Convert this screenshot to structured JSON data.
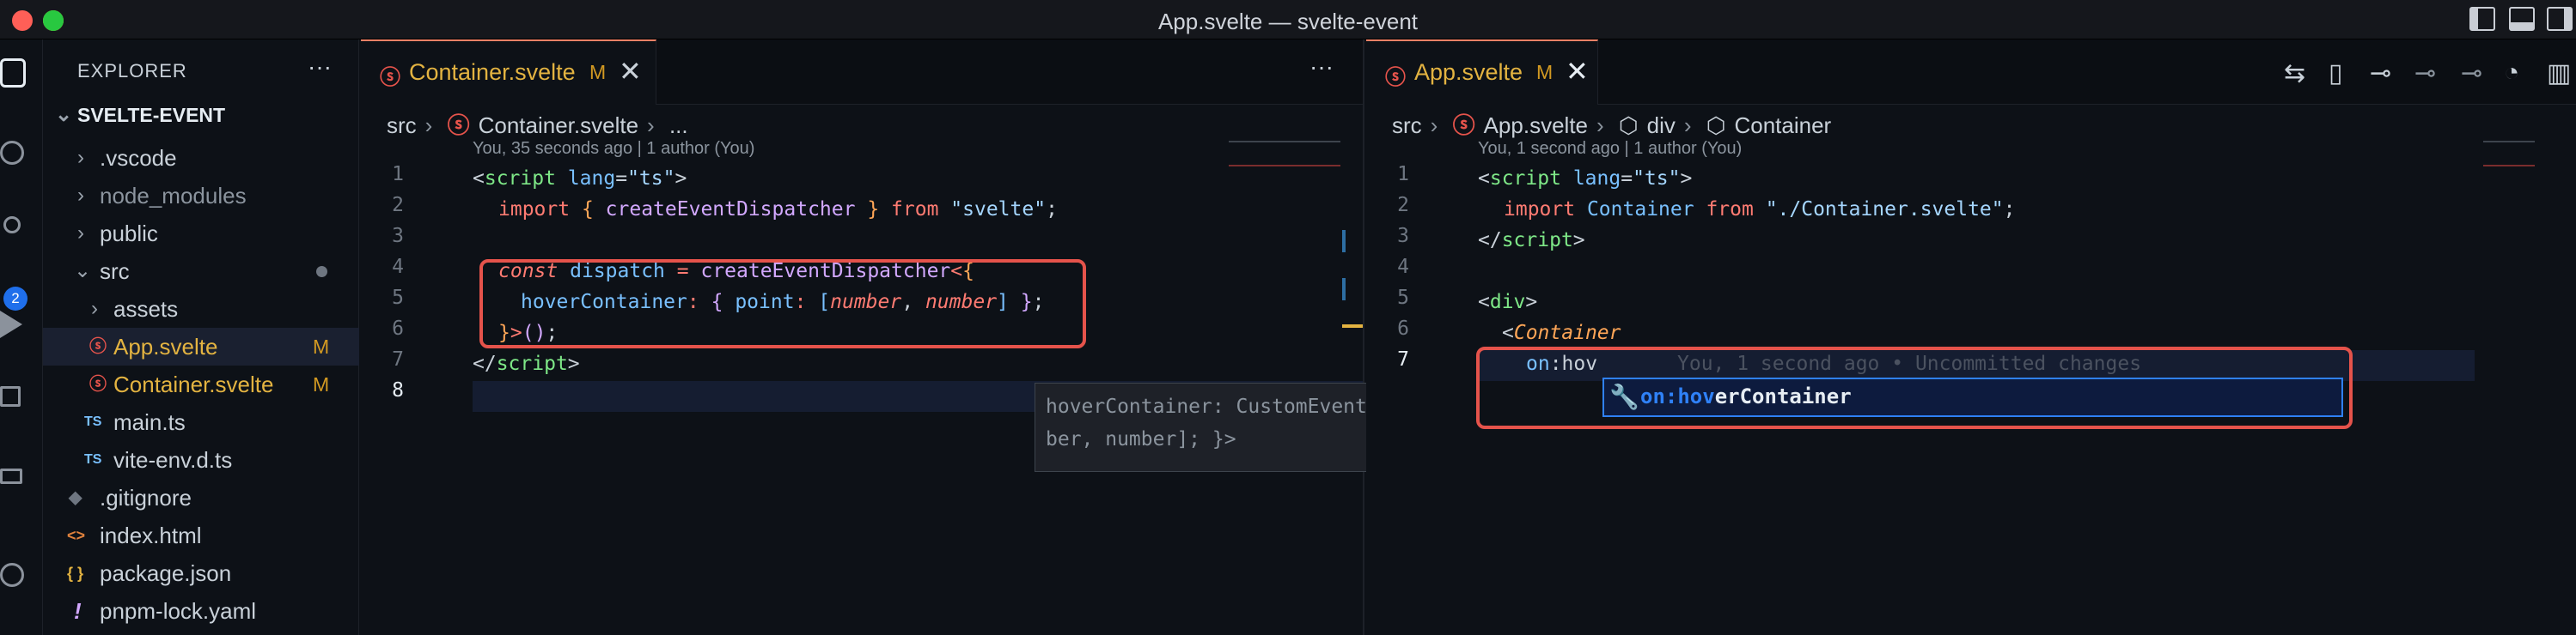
{
  "window": {
    "title": "App.svelte — svelte-event"
  },
  "explorer": {
    "header": "EXPLORER",
    "more": "···",
    "project": "SVELTE-EVENT",
    "items": [
      {
        "label": ".vscode",
        "kind": "folder"
      },
      {
        "label": "node_modules",
        "kind": "folder"
      },
      {
        "label": "public",
        "kind": "folder"
      },
      {
        "label": "src",
        "kind": "folder-open"
      },
      {
        "label": "assets",
        "kind": "folder"
      },
      {
        "label": "App.svelte",
        "kind": "svelte",
        "badge": "M"
      },
      {
        "label": "Container.svelte",
        "kind": "svelte",
        "badge": "M"
      },
      {
        "label": "main.ts",
        "kind": "ts",
        "icon_text": "TS"
      },
      {
        "label": "vite-env.d.ts",
        "kind": "ts",
        "icon_text": "TS"
      },
      {
        "label": ".gitignore",
        "kind": "git"
      },
      {
        "label": "index.html",
        "kind": "html",
        "icon_text": "<>"
      },
      {
        "label": "package.json",
        "kind": "json",
        "icon_text": "{ }"
      },
      {
        "label": "pnpm-lock.yaml",
        "kind": "yaml",
        "icon_text": "!"
      }
    ]
  },
  "activity_bar": {
    "scm_badge": "2"
  },
  "left_editor": {
    "tab": {
      "label": "Container.svelte",
      "modified": "M",
      "close": "✕"
    },
    "more": "···",
    "breadcrumb": [
      "src",
      "Container.svelte",
      "..."
    ],
    "blame": "You, 35 seconds ago | 1 author (You)",
    "line_numbers": [
      "1",
      "2",
      "3",
      "4",
      "5",
      "6",
      "7",
      "8"
    ]
  },
  "hover": {
    "line1": "hoverContainer: CustomEvent<{ point: [num",
    "line2": "ber, number]; }>",
    "close": "✕"
  },
  "right_editor": {
    "tab": {
      "label": "App.svelte",
      "modified": "M",
      "close": "✕"
    },
    "breadcrumb": [
      "src",
      "App.svelte",
      "div",
      "Container"
    ],
    "blame": "You, 1 second ago | 1 author (You)",
    "line_numbers": [
      "1",
      "2",
      "3",
      "4",
      "5",
      "6",
      "7"
    ],
    "inline_blame": "You, 1 second ago • Uncommitted changes",
    "suggestion": {
      "match": "on:hov",
      "rest": "erContainer"
    }
  },
  "colors": {
    "accent": "#2f81f7",
    "highlight": "#e5534b",
    "modified": "#d29922"
  }
}
